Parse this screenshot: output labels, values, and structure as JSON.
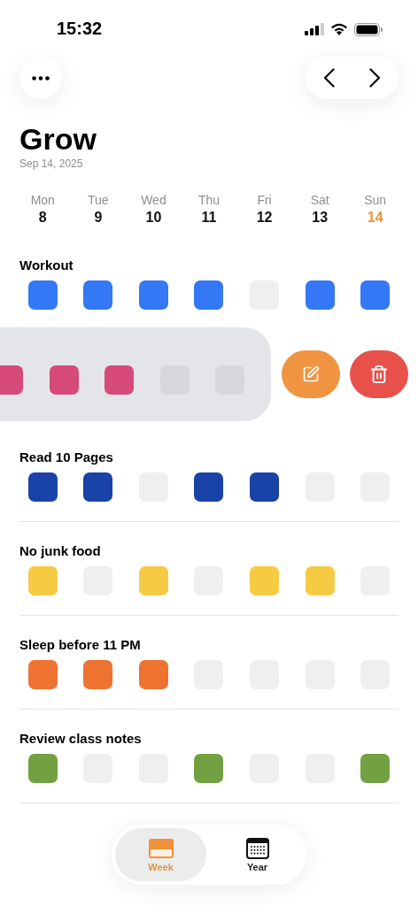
{
  "status_bar": {
    "time": "15:32"
  },
  "header": {
    "title": "Grow",
    "date": "Sep 14, 2025"
  },
  "week": [
    {
      "day": "Mon",
      "date": "8",
      "today": false
    },
    {
      "day": "Tue",
      "date": "9",
      "today": false
    },
    {
      "day": "Wed",
      "date": "10",
      "today": false
    },
    {
      "day": "Thu",
      "date": "11",
      "today": false
    },
    {
      "day": "Fri",
      "date": "12",
      "today": false
    },
    {
      "day": "Sat",
      "date": "13",
      "today": false
    },
    {
      "day": "Sun",
      "date": "14",
      "today": true
    }
  ],
  "habits": [
    {
      "name": "Workout",
      "color": "#3478f6",
      "days": [
        true,
        true,
        true,
        true,
        false,
        true,
        true
      ]
    },
    {
      "kind": "swiped",
      "color": "#d64a7a",
      "days": [
        true,
        true,
        true,
        false,
        false
      ]
    },
    {
      "name": "Read 10 Pages",
      "color": "#1a43a8",
      "days": [
        true,
        true,
        false,
        true,
        true,
        false,
        false
      ]
    },
    {
      "name": "No junk food",
      "color": "#f5cb44",
      "days": [
        true,
        false,
        true,
        false,
        true,
        true,
        false
      ]
    },
    {
      "name": "Sleep before 11 PM",
      "color": "#ee7330",
      "days": [
        true,
        true,
        true,
        false,
        false,
        false,
        false
      ]
    },
    {
      "name": "Review class notes",
      "color": "#72a142",
      "days": [
        true,
        false,
        false,
        true,
        false,
        false,
        true
      ]
    }
  ],
  "tabs": [
    {
      "kind": "week",
      "label": "Week",
      "selected": true
    },
    {
      "kind": "year",
      "label": "Year",
      "selected": false
    }
  ]
}
